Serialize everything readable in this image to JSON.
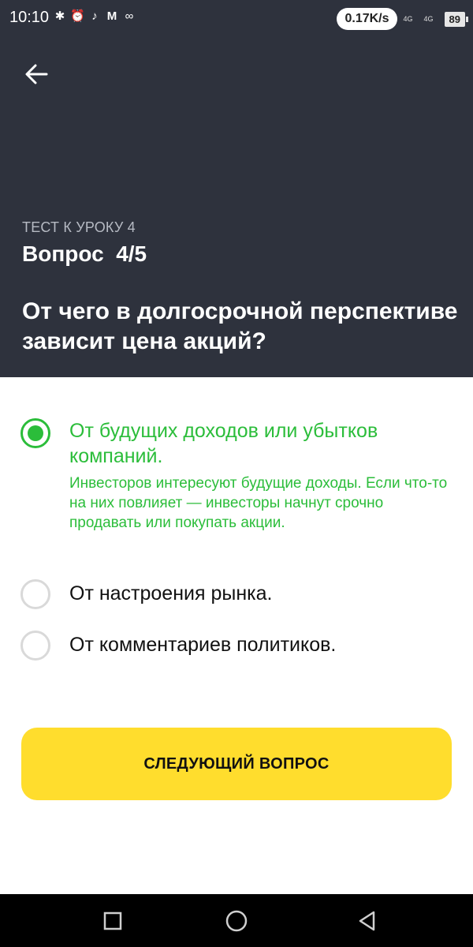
{
  "status_bar": {
    "time": "10:10",
    "speed": "0.17K/s",
    "signal_1": "4G",
    "signal_2": "4G",
    "battery": "89",
    "icons": [
      "bluetooth-icon",
      "alarm-icon",
      "music-icon",
      "m-app-icon",
      "sync-icon"
    ]
  },
  "header": {
    "lesson_label": "ТЕСТ К УРОКУ 4",
    "question_counter": "Вопрос  4/5",
    "question_text": "От чего в долгосрочной перспективе зависит цена акций?"
  },
  "options": [
    {
      "label": "От будущих доходов или убытков компаний.",
      "selected": true,
      "correct": true,
      "explanation": "Инвесторов интересуют будущие доходы. Если что-то на них повлияет — инвесторы начнут срочно продавать или покупать акции."
    },
    {
      "label": "От настроения рынка.",
      "selected": false
    },
    {
      "label": "От комментариев политиков.",
      "selected": false
    }
  ],
  "next_button": {
    "label": "СЛЕДУЮЩИЙ ВОПРОС"
  },
  "colors": {
    "header_bg": "#2e323d",
    "accent_green": "#2bbd3a",
    "button_yellow": "#ffdd2d"
  }
}
